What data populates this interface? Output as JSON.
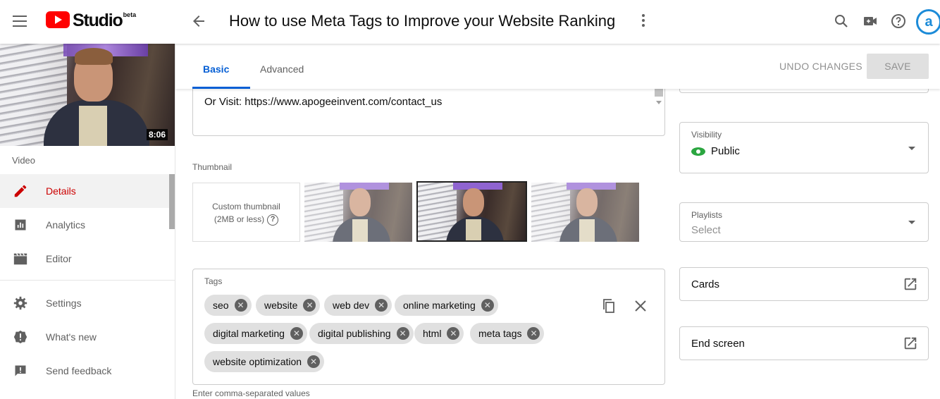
{
  "app": {
    "brand": "Studio",
    "badge": "beta"
  },
  "header": {
    "title": "How to use Meta Tags to Improve your Website Ranking",
    "avatar_text": "a"
  },
  "sidebar": {
    "video_duration": "8:06",
    "section_label": "Video",
    "items": [
      {
        "label": "Details",
        "icon": "pencil-icon",
        "active": true
      },
      {
        "label": "Analytics",
        "icon": "analytics-icon"
      },
      {
        "label": "Editor",
        "icon": "clapperboard-icon"
      },
      {
        "label": "Settings",
        "icon": "gear-icon"
      },
      {
        "label": "What's new",
        "icon": "alert-badge-icon"
      },
      {
        "label": "Send feedback",
        "icon": "feedback-icon"
      }
    ]
  },
  "tabs": [
    {
      "label": "Basic",
      "active": true
    },
    {
      "label": "Advanced"
    }
  ],
  "actions": {
    "undo": "UNDO CHANGES",
    "save": "SAVE"
  },
  "description": {
    "visible_text": "Or Visit: https://www.apogeeinvent.com/contact_us"
  },
  "thumbnail": {
    "label": "Thumbnail",
    "custom_line1": "Custom thumbnail",
    "custom_line2": "(2MB or less)",
    "help": "?",
    "options_count": 3,
    "selected_index": 1
  },
  "tags": {
    "label": "Tags",
    "items": [
      "seo",
      "website",
      "web dev",
      "online marketing",
      "digital marketing",
      "digital publishing",
      "html",
      "meta tags",
      "website optimization"
    ],
    "hint": "Enter comma-separated values",
    "remove_glyph": "✕"
  },
  "right": {
    "visibility": {
      "label": "Visibility",
      "value": "Public"
    },
    "playlists": {
      "label": "Playlists",
      "placeholder": "Select"
    },
    "cards": {
      "label": "Cards"
    },
    "end_screen": {
      "label": "End screen"
    }
  },
  "colors": {
    "accent": "#065fd4",
    "active": "#cc0000",
    "brand_red": "#ff0000",
    "public_green": "#2ba640"
  }
}
